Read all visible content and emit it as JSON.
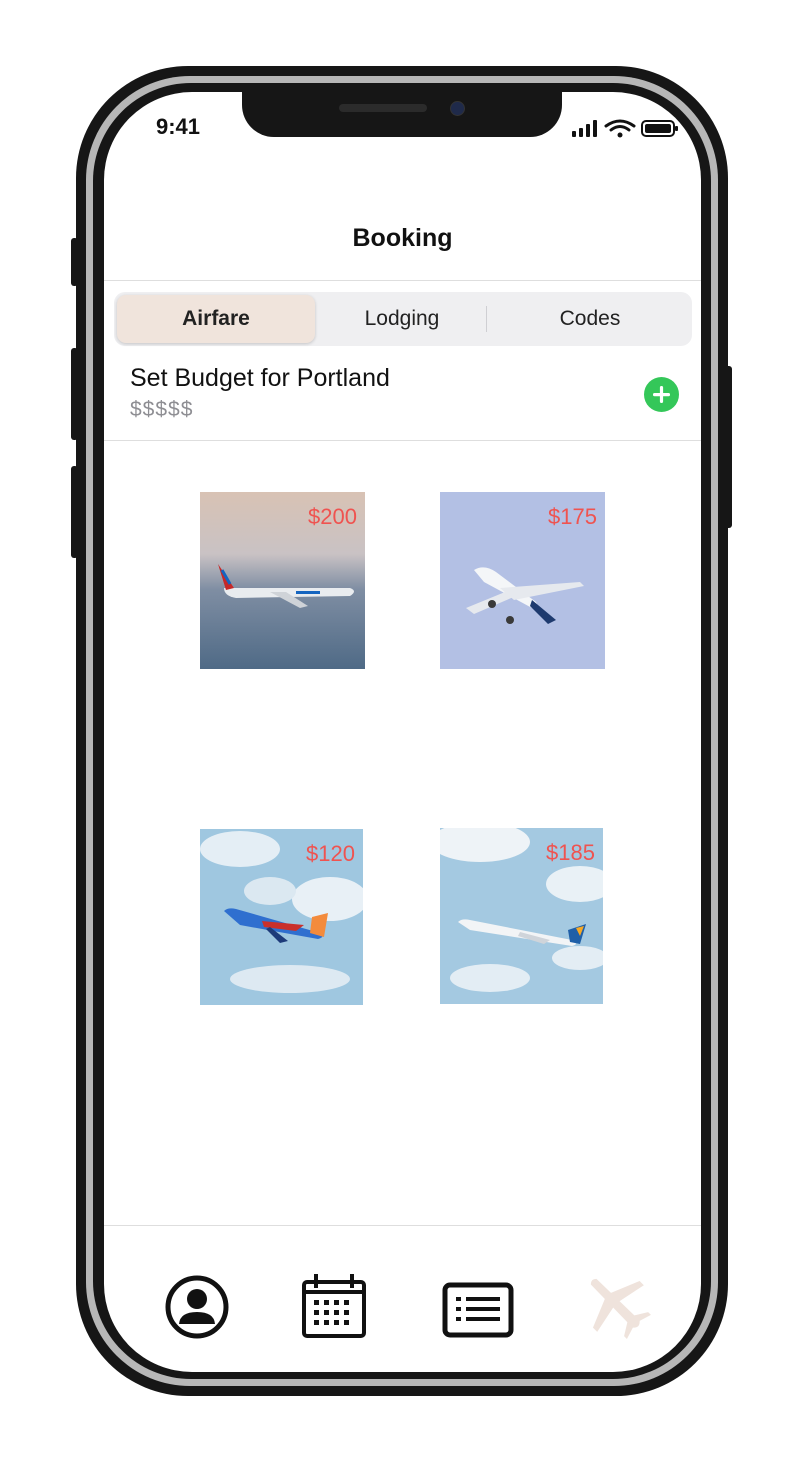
{
  "status_bar": {
    "time": "9:41"
  },
  "header": {
    "title": "Booking"
  },
  "segments": [
    {
      "label": "Airfare",
      "active": true
    },
    {
      "label": "Lodging",
      "active": false
    },
    {
      "label": "Codes",
      "active": false
    }
  ],
  "budget": {
    "title": "Set Budget for Portland",
    "amount": "$$$$$",
    "add_icon": "plus-circle-icon"
  },
  "flights": [
    {
      "price": "$200",
      "image": "american-airlines-plane"
    },
    {
      "price": "$175",
      "image": "alaska-airlines-plane"
    },
    {
      "price": "$120",
      "image": "southwest-airlines-plane"
    },
    {
      "price": "$185",
      "image": "allegiant-plane"
    }
  ],
  "tab_bar": {
    "tabs": [
      {
        "icon": "profile-icon",
        "active": false
      },
      {
        "icon": "calendar-icon",
        "active": false
      },
      {
        "icon": "list-icon",
        "active": false
      },
      {
        "icon": "airplane-icon",
        "active": true
      }
    ]
  },
  "colors": {
    "accent": "#f0e4dc",
    "add_button": "#34c759",
    "price": "#ef5350"
  }
}
